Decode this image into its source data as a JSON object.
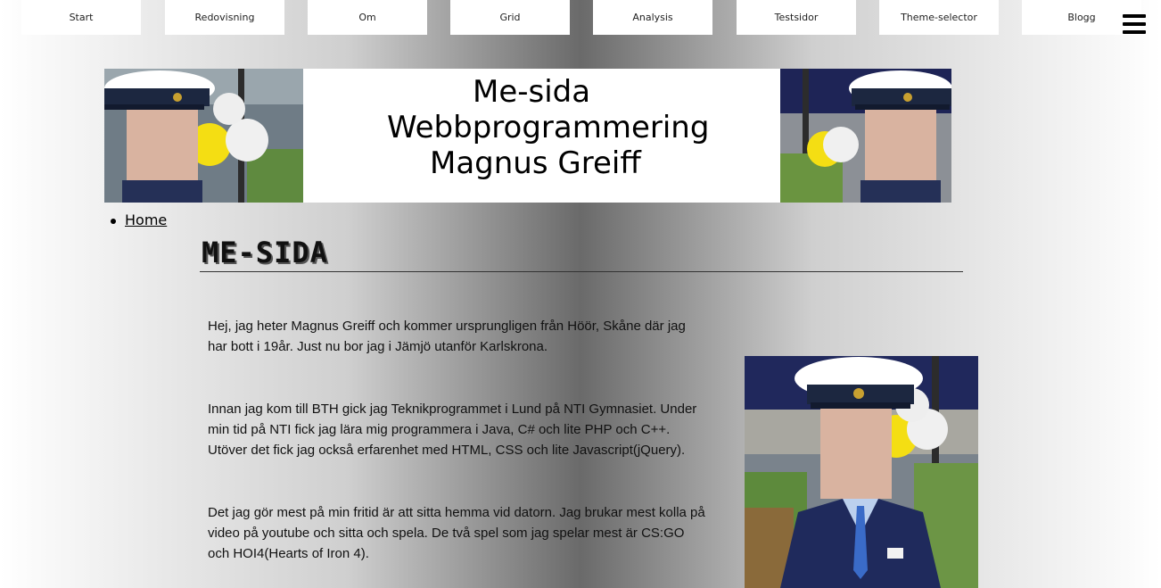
{
  "nav": {
    "items": [
      "Start",
      "Redovisning",
      "Om",
      "Grid",
      "Analysis",
      "Testsidor",
      "Theme-selector",
      "Blogg"
    ]
  },
  "banner": {
    "line1": "Me-sida",
    "line2": "Webbprogrammering",
    "line3": "Magnus Greiff"
  },
  "breadcrumb": {
    "home": "Home"
  },
  "page": {
    "title": "ME-SIDA"
  },
  "content": {
    "para1": "Hej, jag heter Magnus Greiff och kommer ursprungligen från Höör, Skåne där jag har bott i 19år. Just nu bor jag i Jämjö utanför Karlskrona.",
    "para2": "Innan jag kom till BTH gick jag Teknikprogrammet i Lund på NTI Gymnasiet. Under min tid på NTI fick jag lära mig programmera i Java, C# och lite PHP och C++. Utöver det fick jag också erfarenhet med HTML, CSS och lite Javascript(jQuery).",
    "para3": "Det jag gör mest på min fritid är att sitta hemma vid datorn. Jag brukar mest kolla på video på youtube och sitta och spela. De två spel som jag spelar mest är CS:GO och HOI4(Hearts of Iron 4)."
  },
  "colors": {
    "page_gradient_mid": "#6a6a6a",
    "nav_bg": "#ffffff",
    "cap_navy": "#1c2740"
  },
  "icons": {
    "menu": "hamburger-icon"
  }
}
